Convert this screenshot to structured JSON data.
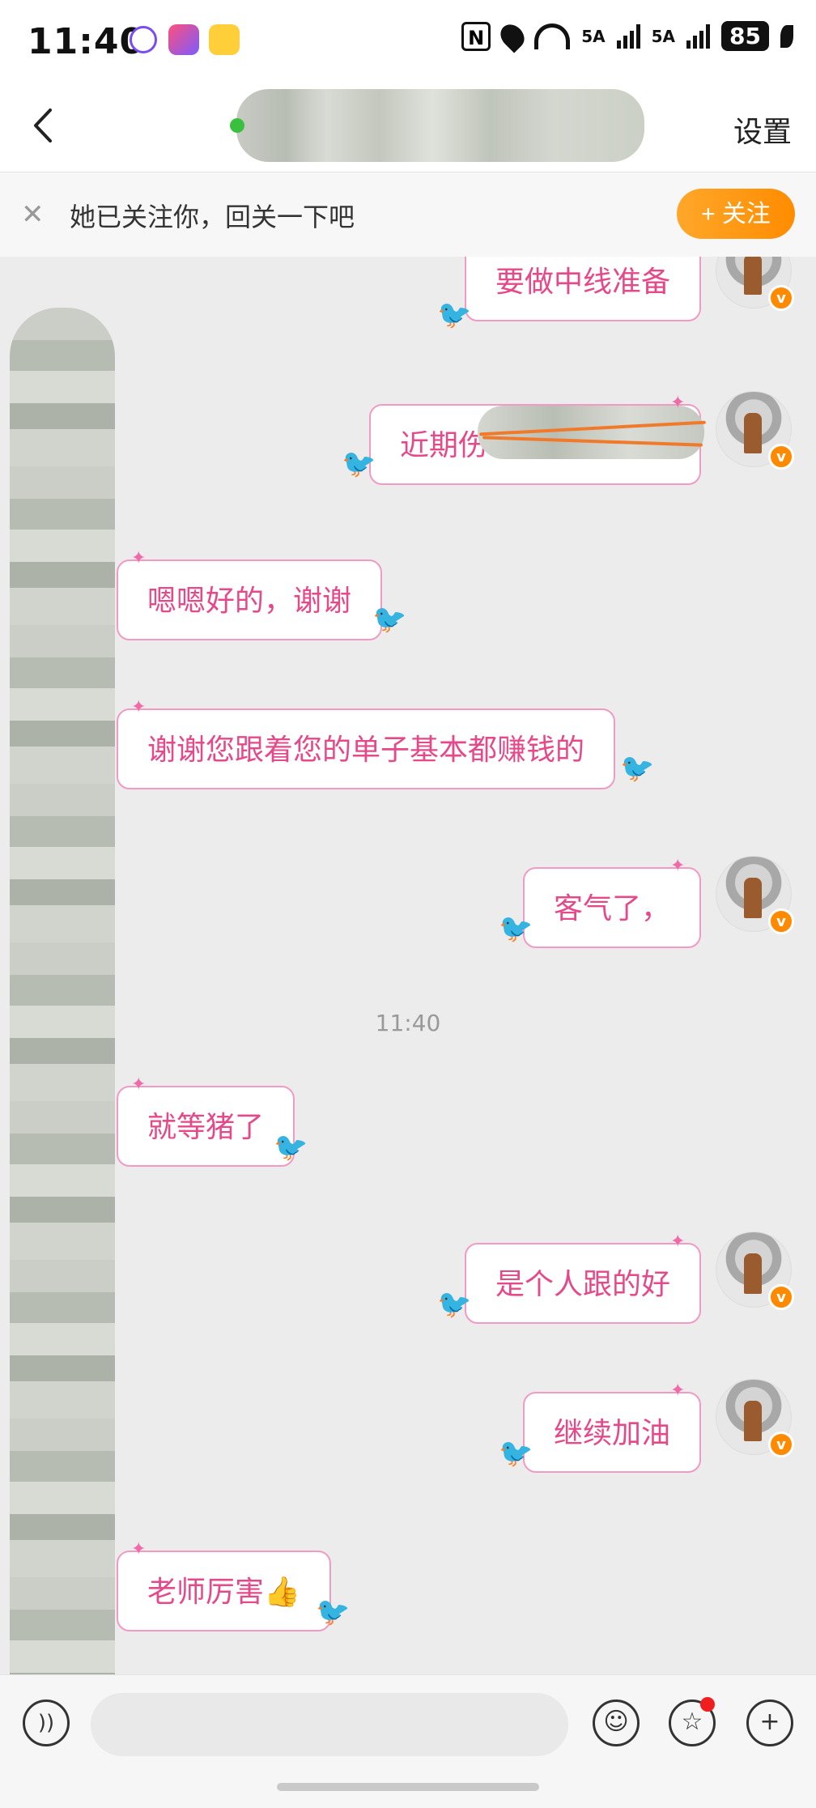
{
  "status_bar": {
    "time": "11:40",
    "battery": "85",
    "signal_1": "5A",
    "signal_2": "5A"
  },
  "header": {
    "back_label": "‹",
    "settings_label": "设置"
  },
  "follow_banner": {
    "text": "她已关注你，回关一下吧",
    "button_label": "+ 关注",
    "close_label": "✕"
  },
  "messages": [
    {
      "side": "right",
      "text": "要做中线准备"
    },
    {
      "side": "right",
      "text": "近期伤"
    },
    {
      "side": "left",
      "text": "嗯嗯好的，谢谢"
    },
    {
      "side": "left",
      "text": "谢谢您跟着您的单子基本都赚钱的"
    },
    {
      "side": "right",
      "text": "客气了，"
    },
    {
      "side": "left",
      "text": "就等猪了"
    },
    {
      "side": "right",
      "text": "是个人跟的好"
    },
    {
      "side": "right",
      "text": "继续加油"
    },
    {
      "side": "left",
      "text": "老师厉害👍"
    }
  ],
  "timestamp": "11:40",
  "badge_letter": "v",
  "icons": [
    "back-icon",
    "close-icon",
    "voice-icon",
    "emoji-icon",
    "sticker-icon",
    "plus-icon",
    "bird-sticker-icon"
  ],
  "colors": {
    "bubble_text": "#e5498a",
    "bubble_border": "#f19ac4",
    "follow_button": "#ff8c00",
    "verified_badge": "#ff8a00"
  }
}
